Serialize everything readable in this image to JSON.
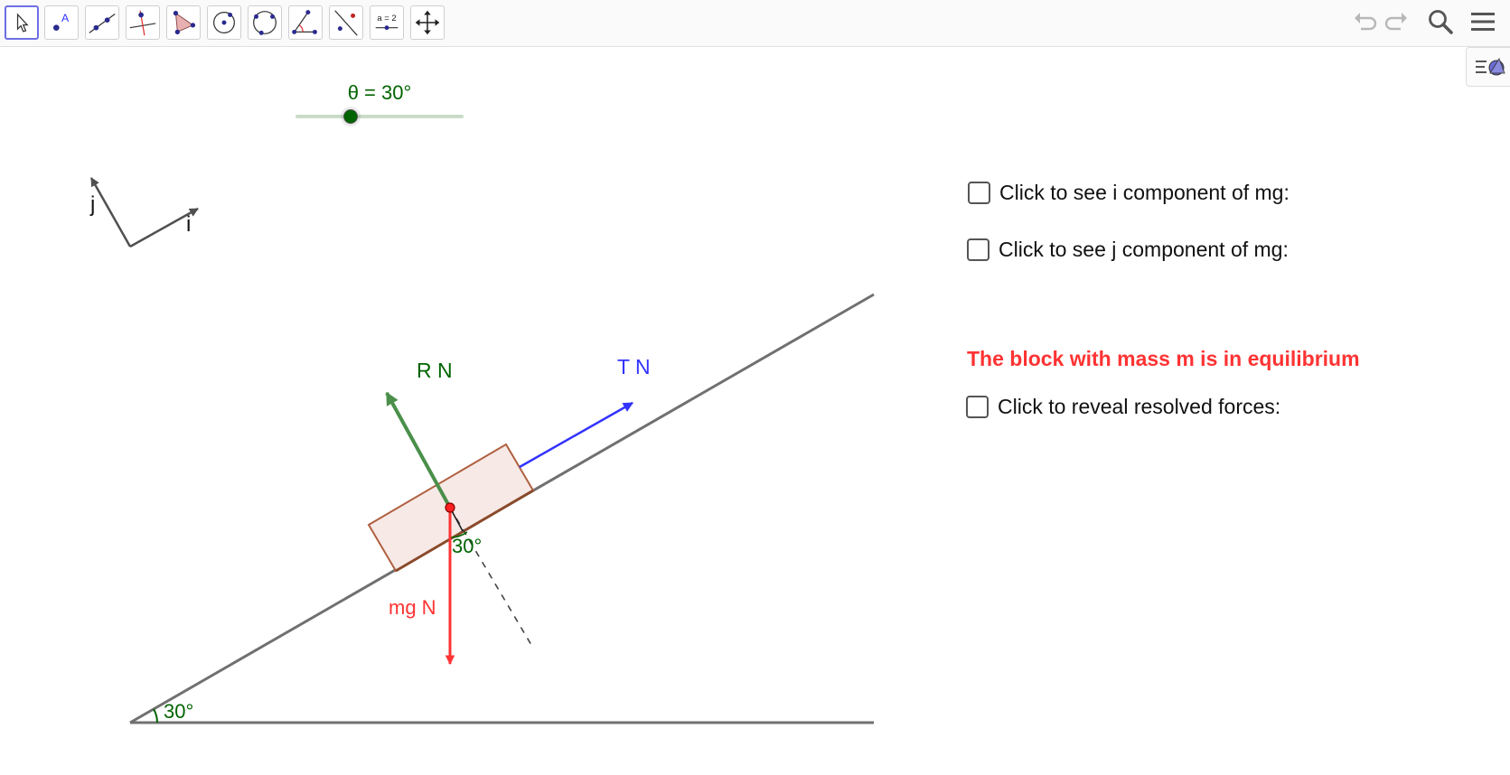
{
  "colors": {
    "green": "#006400",
    "force_green": "#4a8f4a",
    "red": "#ff3333",
    "blue": "#3333ff",
    "block_fill": "#f6e9e6",
    "block_edge": "#b06040",
    "incline": "#707070",
    "active_tool": "#6e6ee6"
  },
  "toolbar": {
    "tools": [
      {
        "name": "move-tool-icon"
      },
      {
        "name": "point-tool-icon",
        "label": "A"
      },
      {
        "name": "line-tool-icon"
      },
      {
        "name": "perpendicular-line-tool-icon"
      },
      {
        "name": "polygon-tool-icon"
      },
      {
        "name": "circle-center-point-tool-icon"
      },
      {
        "name": "circle-three-points-tool-icon"
      },
      {
        "name": "angle-tool-icon"
      },
      {
        "name": "reflect-tool-icon"
      },
      {
        "name": "slider-tool-icon",
        "label": "a = 2"
      },
      {
        "name": "move-graphics-view-tool-icon"
      }
    ],
    "right_icons": [
      "undo-icon",
      "redo-icon",
      "search-icon",
      "menu-icon"
    ]
  },
  "slider": {
    "label": "θ = 30°",
    "value_fraction": 0.33
  },
  "axes": {
    "i_label": "i",
    "j_label": "j"
  },
  "forces": {
    "reaction_label": "R N",
    "tension_label": "T N",
    "weight_label": "mg N",
    "block_angle_label": "30°"
  },
  "incline": {
    "angle_label": "30°",
    "angle_deg": 30
  },
  "panel": {
    "checkbox_i": "Click to see i component of mg:",
    "checkbox_j": "Click to see j component of mg:",
    "equilibrium_text": "The block with mass m is in equilibrium",
    "checkbox_resolve": "Click to reveal resolved forces:"
  }
}
